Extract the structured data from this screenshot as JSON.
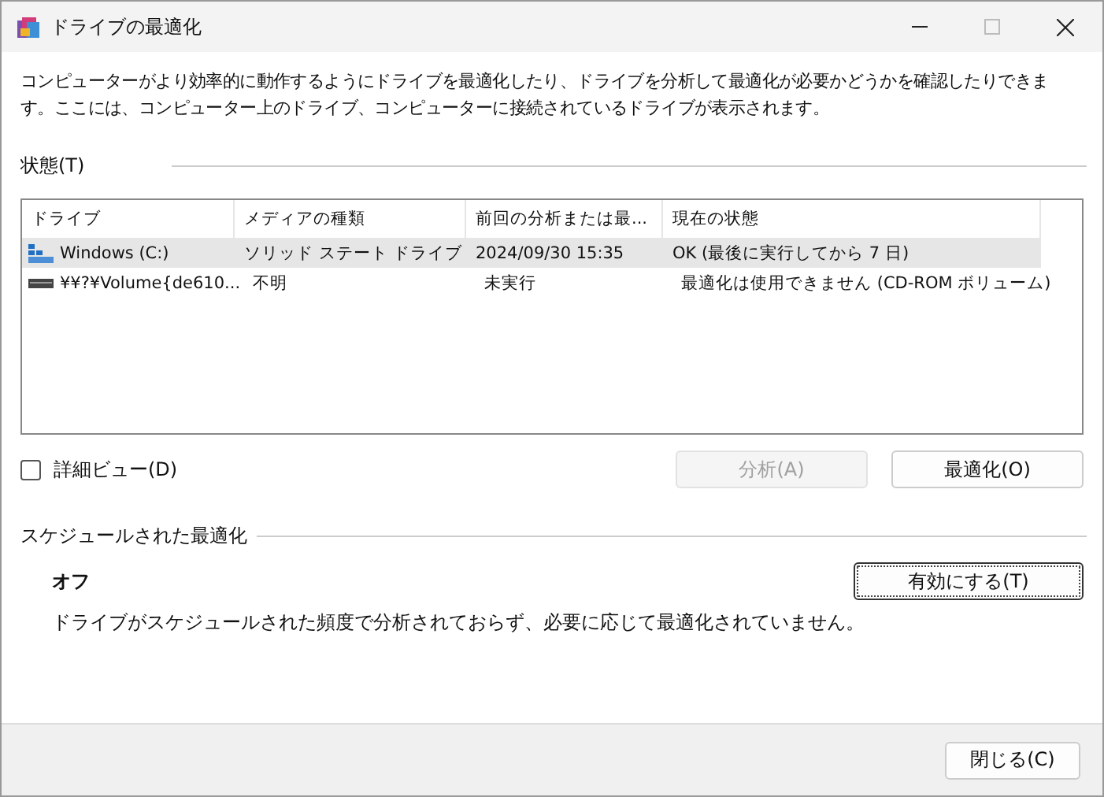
{
  "window": {
    "title": "ドライブの最適化"
  },
  "description": "コンピューターがより効率的に動作するようにドライブを最適化したり、ドライブを分析して最適化が必要かどうかを確認したりできます。ここには、コンピューター上のドライブ、コンピューターに接続されているドライブが表示されます。",
  "status_heading": "状態(T)",
  "table": {
    "columns": [
      "ドライブ",
      "メディアの種類",
      "前回の分析または最...",
      "現在の状態"
    ],
    "rows": [
      {
        "kind": "ssd",
        "selected": true,
        "cells": [
          "Windows  (C:)",
          "ソリッド ステート ドライブ",
          "2024/09/30 15:35",
          "OK (最後に実行してから 7 日)"
        ]
      },
      {
        "kind": "cdrom",
        "selected": false,
        "cells": [
          "¥¥?¥Volume{de610...",
          "不明",
          "未実行",
          "最適化は使用できません (CD-ROM ボリューム)"
        ]
      }
    ]
  },
  "detail_view": {
    "label": "詳細ビュー(D)",
    "checked": false
  },
  "buttons": [
    {
      "label": "分析(A)",
      "disabled": true
    },
    {
      "label": "最適化(O)",
      "disabled": false
    }
  ],
  "schedule": {
    "heading": "スケジュールされた最適化",
    "state": "オフ",
    "message": "ドライブがスケジュールされた頻度で分析されておらず、必要に応じて最適化されていません。",
    "button": "有効にする(T)"
  },
  "close_button": "閉じる(C)"
}
